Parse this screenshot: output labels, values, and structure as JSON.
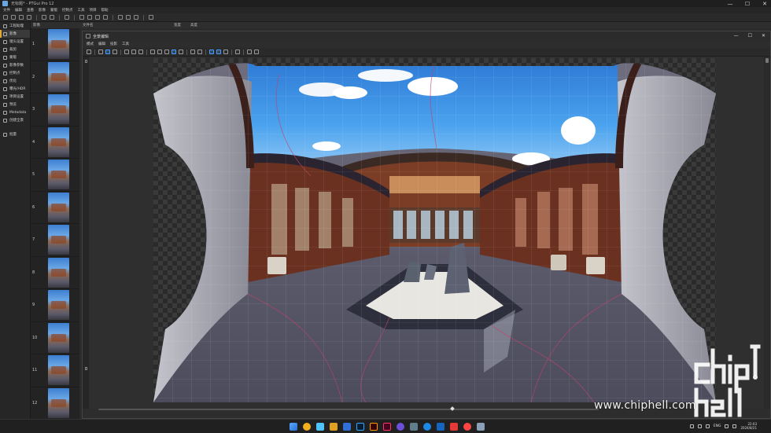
{
  "window": {
    "title": "无标题* - PTGui Pro 12",
    "controls": [
      "—",
      "☐",
      "✕"
    ]
  },
  "menubar": [
    "文件",
    "编辑",
    "查看",
    "影像",
    "蒙版",
    "控制点",
    "工具",
    "项目",
    "帮助"
  ],
  "leftnav": {
    "items": [
      {
        "label": "工程助理",
        "icon": "home-icon"
      },
      {
        "label": "影像",
        "icon": "image-icon",
        "active": true
      },
      {
        "label": "镜头设置",
        "icon": "lens-icon"
      },
      {
        "label": "裁剪",
        "icon": "crop-icon"
      },
      {
        "label": "蒙版",
        "icon": "mask-icon"
      },
      {
        "label": "影像参数",
        "icon": "sliders-icon"
      },
      {
        "label": "控制点",
        "icon": "control-points-icon"
      },
      {
        "label": "优化",
        "icon": "optimize-icon"
      },
      {
        "label": "曝光/HDR",
        "icon": "exposure-icon"
      },
      {
        "label": "项目设置",
        "icon": "settings-icon"
      },
      {
        "label": "预览",
        "icon": "eye-icon"
      },
      {
        "label": "Metadata",
        "icon": "metadata-icon"
      },
      {
        "label": "创建全景",
        "icon": "create-panorama-icon"
      },
      {
        "label": "批量",
        "icon": "batch-icon"
      }
    ]
  },
  "imagelist": {
    "header_image": "影像",
    "header_file": "文件名",
    "header_width": "宽度",
    "header_height": "高度",
    "rows": [
      "1",
      "2",
      "3",
      "4",
      "5",
      "6",
      "7",
      "8",
      "9",
      "10",
      "11",
      "12"
    ]
  },
  "editor": {
    "title": "全景编辑",
    "menu": [
      "模式",
      "编辑",
      "投影",
      "工具"
    ],
    "controls": [
      "—",
      "☐",
      "✕"
    ]
  },
  "taskbar": {
    "lang": "ENG",
    "time": "22:03",
    "date": "2024/8/21",
    "apps": [
      "#3b82f6",
      "#f2b01e",
      "#4fc3f7",
      "#e0a020",
      "#2f6fd6",
      "#001e36",
      "#ff9a00",
      "#ff3366",
      "#6b4fd8",
      "#31a8ff",
      "#1e88e5",
      "#e53935",
      "#ff4444",
      "#607d8b"
    ]
  },
  "watermark": {
    "url": "www.chiphell.com",
    "logo_text": "chiphell"
  }
}
